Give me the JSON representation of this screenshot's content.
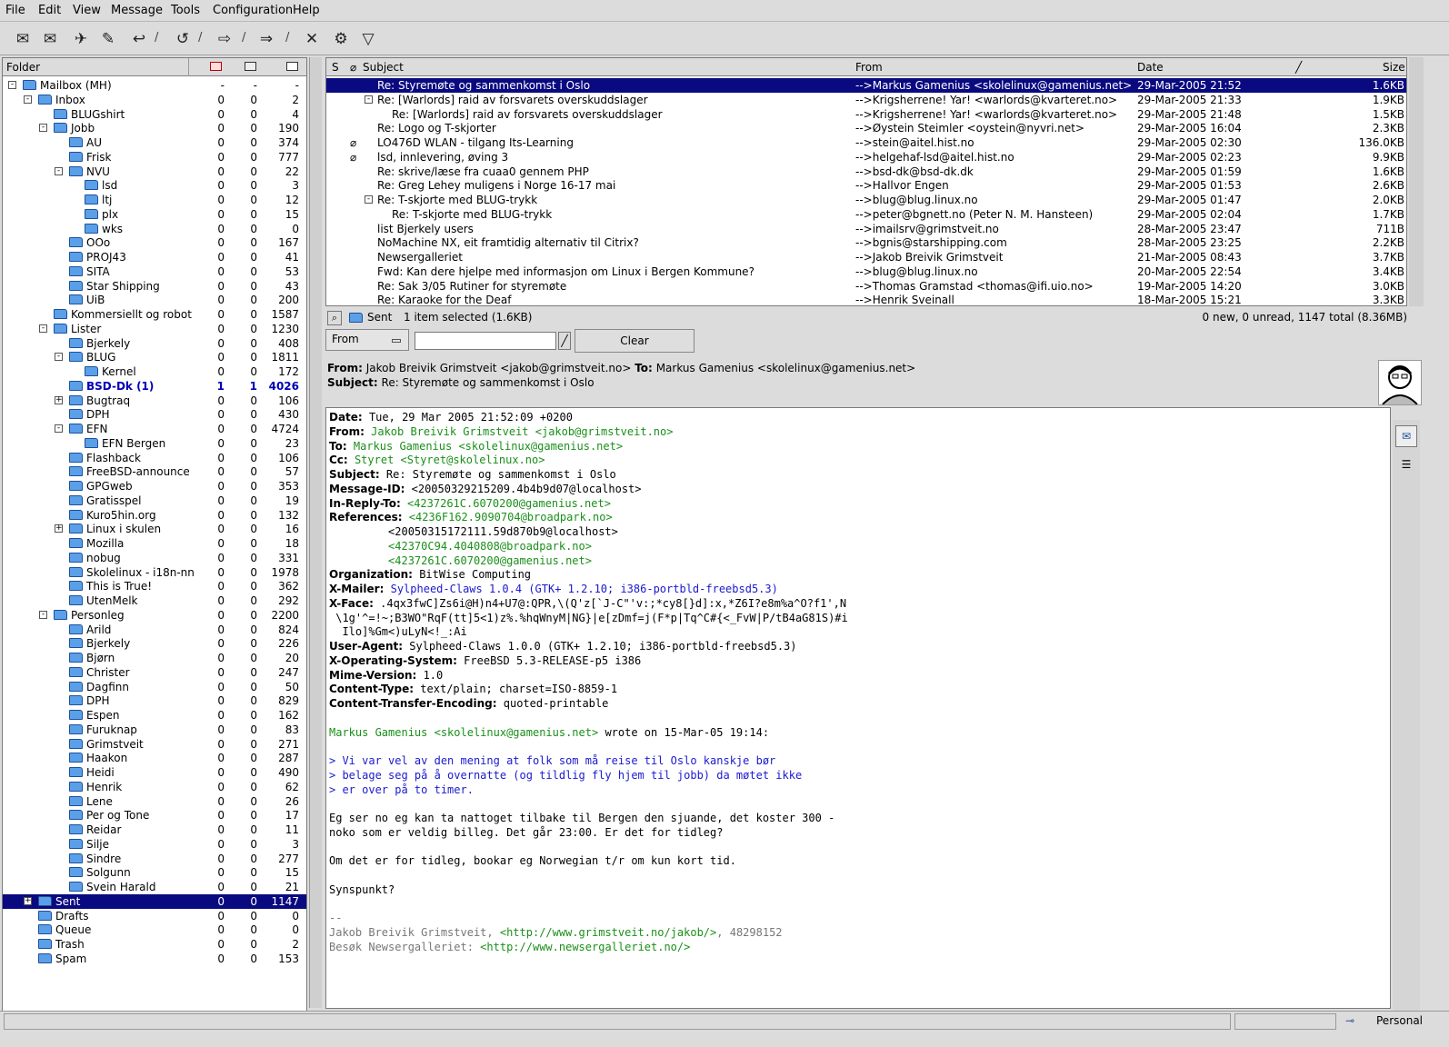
{
  "menu": [
    "File",
    "Edit",
    "View",
    "Message",
    "Tools",
    "Configuration",
    "Help"
  ],
  "toolbar_icons": [
    "get-mail-icon",
    "get-all-icon",
    "send-icon",
    "compose-icon",
    "reply-icon",
    "reply-all-icon",
    "forward-icon",
    "next-icon",
    "delete-icon",
    "execute-icon",
    "filter-icon"
  ],
  "folder_header": {
    "title": "Folder"
  },
  "folders": [
    {
      "name": "Mailbox (MH)",
      "n": "-",
      "u": "-",
      "t": "-",
      "level": 0,
      "exp": "-"
    },
    {
      "name": "Inbox",
      "n": "0",
      "u": "0",
      "t": "2",
      "level": 1,
      "exp": "-"
    },
    {
      "name": "BLUGshirt",
      "n": "0",
      "u": "0",
      "t": "4",
      "level": 2
    },
    {
      "name": "Jobb",
      "n": "0",
      "u": "0",
      "t": "190",
      "level": 2,
      "exp": "-"
    },
    {
      "name": "AU",
      "n": "0",
      "u": "0",
      "t": "374",
      "level": 3
    },
    {
      "name": "Frisk",
      "n": "0",
      "u": "0",
      "t": "777",
      "level": 3
    },
    {
      "name": "NVU",
      "n": "0",
      "u": "0",
      "t": "22",
      "level": 3,
      "exp": "-"
    },
    {
      "name": "lsd",
      "n": "0",
      "u": "0",
      "t": "3",
      "level": 4
    },
    {
      "name": "ltj",
      "n": "0",
      "u": "0",
      "t": "12",
      "level": 4
    },
    {
      "name": "plx",
      "n": "0",
      "u": "0",
      "t": "15",
      "level": 4
    },
    {
      "name": "wks",
      "n": "0",
      "u": "0",
      "t": "0",
      "level": 4
    },
    {
      "name": "OOo",
      "n": "0",
      "u": "0",
      "t": "167",
      "level": 3
    },
    {
      "name": "PROJ43",
      "n": "0",
      "u": "0",
      "t": "41",
      "level": 3
    },
    {
      "name": "SITA",
      "n": "0",
      "u": "0",
      "t": "53",
      "level": 3
    },
    {
      "name": "Star Shipping",
      "n": "0",
      "u": "0",
      "t": "43",
      "level": 3
    },
    {
      "name": "UiB",
      "n": "0",
      "u": "0",
      "t": "200",
      "level": 3
    },
    {
      "name": "Kommersiellt og robot",
      "n": "0",
      "u": "0",
      "t": "1587",
      "level": 2
    },
    {
      "name": "Lister",
      "n": "0",
      "u": "0",
      "t": "1230",
      "level": 2,
      "exp": "-"
    },
    {
      "name": "Bjerkely",
      "n": "0",
      "u": "0",
      "t": "408",
      "level": 3
    },
    {
      "name": "BLUG",
      "n": "0",
      "u": "0",
      "t": "1811",
      "level": 3,
      "exp": "-"
    },
    {
      "name": "Kernel",
      "n": "0",
      "u": "0",
      "t": "172",
      "level": 4
    },
    {
      "name": "BSD-Dk (1)",
      "n": "1",
      "u": "1",
      "t": "4026",
      "level": 3,
      "bold": true
    },
    {
      "name": "Bugtraq",
      "n": "0",
      "u": "0",
      "t": "106",
      "level": 3,
      "exp": "+"
    },
    {
      "name": "DPH",
      "n": "0",
      "u": "0",
      "t": "430",
      "level": 3
    },
    {
      "name": "EFN",
      "n": "0",
      "u": "0",
      "t": "4724",
      "level": 3,
      "exp": "-"
    },
    {
      "name": "EFN Bergen",
      "n": "0",
      "u": "0",
      "t": "23",
      "level": 4
    },
    {
      "name": "Flashback",
      "n": "0",
      "u": "0",
      "t": "106",
      "level": 3
    },
    {
      "name": "FreeBSD-announce",
      "n": "0",
      "u": "0",
      "t": "57",
      "level": 3
    },
    {
      "name": "GPGweb",
      "n": "0",
      "u": "0",
      "t": "353",
      "level": 3
    },
    {
      "name": "Gratisspel",
      "n": "0",
      "u": "0",
      "t": "19",
      "level": 3
    },
    {
      "name": "Kuro5hin.org",
      "n": "0",
      "u": "0",
      "t": "132",
      "level": 3
    },
    {
      "name": "Linux i skulen",
      "n": "0",
      "u": "0",
      "t": "16",
      "level": 3,
      "exp": "+"
    },
    {
      "name": "Mozilla",
      "n": "0",
      "u": "0",
      "t": "18",
      "level": 3
    },
    {
      "name": "nobug",
      "n": "0",
      "u": "0",
      "t": "331",
      "level": 3
    },
    {
      "name": "Skolelinux - i18n-nn",
      "n": "0",
      "u": "0",
      "t": "1978",
      "level": 3
    },
    {
      "name": "This is True!",
      "n": "0",
      "u": "0",
      "t": "362",
      "level": 3
    },
    {
      "name": "UtenMelk",
      "n": "0",
      "u": "0",
      "t": "292",
      "level": 3
    },
    {
      "name": "Personleg",
      "n": "0",
      "u": "0",
      "t": "2200",
      "level": 2,
      "exp": "-"
    },
    {
      "name": "Arild",
      "n": "0",
      "u": "0",
      "t": "824",
      "level": 3
    },
    {
      "name": "Bjerkely",
      "n": "0",
      "u": "0",
      "t": "226",
      "level": 3
    },
    {
      "name": "Bjørn",
      "n": "0",
      "u": "0",
      "t": "20",
      "level": 3
    },
    {
      "name": "Christer",
      "n": "0",
      "u": "0",
      "t": "247",
      "level": 3
    },
    {
      "name": "Dagfinn",
      "n": "0",
      "u": "0",
      "t": "50",
      "level": 3
    },
    {
      "name": "DPH",
      "n": "0",
      "u": "0",
      "t": "829",
      "level": 3
    },
    {
      "name": "Espen",
      "n": "0",
      "u": "0",
      "t": "162",
      "level": 3
    },
    {
      "name": "Furuknap",
      "n": "0",
      "u": "0",
      "t": "83",
      "level": 3
    },
    {
      "name": "Grimstveit",
      "n": "0",
      "u": "0",
      "t": "271",
      "level": 3
    },
    {
      "name": "Haakon",
      "n": "0",
      "u": "0",
      "t": "287",
      "level": 3
    },
    {
      "name": "Heidi",
      "n": "0",
      "u": "0",
      "t": "490",
      "level": 3
    },
    {
      "name": "Henrik",
      "n": "0",
      "u": "0",
      "t": "62",
      "level": 3
    },
    {
      "name": "Lene",
      "n": "0",
      "u": "0",
      "t": "26",
      "level": 3
    },
    {
      "name": "Per og Tone",
      "n": "0",
      "u": "0",
      "t": "17",
      "level": 3
    },
    {
      "name": "Reidar",
      "n": "0",
      "u": "0",
      "t": "11",
      "level": 3
    },
    {
      "name": "Silje",
      "n": "0",
      "u": "0",
      "t": "3",
      "level": 3
    },
    {
      "name": "Sindre",
      "n": "0",
      "u": "0",
      "t": "277",
      "level": 3
    },
    {
      "name": "Solgunn",
      "n": "0",
      "u": "0",
      "t": "15",
      "level": 3
    },
    {
      "name": "Svein Harald",
      "n": "0",
      "u": "0",
      "t": "21",
      "level": 3
    },
    {
      "name": "Sent",
      "n": "0",
      "u": "0",
      "t": "1147",
      "level": 1,
      "sel": true,
      "exp": "+"
    },
    {
      "name": "Drafts",
      "n": "0",
      "u": "0",
      "t": "0",
      "level": 1
    },
    {
      "name": "Queue",
      "n": "0",
      "u": "0",
      "t": "0",
      "level": 1
    },
    {
      "name": "Trash",
      "n": "0",
      "u": "0",
      "t": "2",
      "level": 1
    },
    {
      "name": "Spam",
      "n": "0",
      "u": "0",
      "t": "153",
      "level": 1
    }
  ],
  "list_header": {
    "s": "S",
    "subject": "Subject",
    "from": "From",
    "date": "Date",
    "size": "Size"
  },
  "messages": [
    {
      "subject": "Re: Styremøte og sammenkomst i Oslo",
      "from": "-->Markus Gamenius <skolelinux@gamenius.net>",
      "date": "29-Mar-2005 21:52",
      "size": "1.6KB",
      "sel": true,
      "indent": 1
    },
    {
      "subject": "Re: [Warlords] raid av forsvarets overskuddslager",
      "from": "-->Krigsherrene! Yar! <warlords@kvarteret.no>",
      "date": "29-Mar-2005 21:33",
      "size": "1.9KB",
      "indent": 1,
      "exp": true
    },
    {
      "subject": "Re: [Warlords] raid av forsvarets overskuddslager",
      "from": "-->Krigsherrene! Yar! <warlords@kvarteret.no>",
      "date": "29-Mar-2005 21:48",
      "size": "1.5KB",
      "indent": 2
    },
    {
      "subject": "Re: Logo og T-skjorter",
      "from": "-->Øystein Steimler <oystein@nyvri.net>",
      "date": "29-Mar-2005 16:04",
      "size": "2.3KB",
      "indent": 1
    },
    {
      "subject": "LO476D WLAN - tilgang Its-Learning",
      "from": "-->stein@aitel.hist.no",
      "date": "29-Mar-2005 02:30",
      "size": "136.0KB",
      "clip": true,
      "indent": 1
    },
    {
      "subject": "lsd, innlevering, øving 3",
      "from": "-->helgehaf-lsd@aitel.hist.no",
      "date": "29-Mar-2005 02:23",
      "size": "9.9KB",
      "clip": true,
      "indent": 1
    },
    {
      "subject": "Re: skrive/læse fra cuaa0 gennem PHP",
      "from": "-->bsd-dk@bsd-dk.dk",
      "date": "29-Mar-2005 01:59",
      "size": "1.6KB",
      "indent": 1
    },
    {
      "subject": "Re: Greg Lehey muligens i Norge 16-17 mai",
      "from": "-->Hallvor Engen",
      "date": "29-Mar-2005 01:53",
      "size": "2.6KB",
      "indent": 1
    },
    {
      "subject": "Re: T-skjorte med BLUG-trykk",
      "from": "-->blug@blug.linux.no",
      "date": "29-Mar-2005 01:47",
      "size": "2.0KB",
      "indent": 1,
      "exp": true
    },
    {
      "subject": "Re: T-skjorte med BLUG-trykk",
      "from": "-->peter@bgnett.no (Peter N. M. Hansteen)",
      "date": "29-Mar-2005 02:04",
      "size": "1.7KB",
      "indent": 2
    },
    {
      "subject": "list Bjerkely users",
      "from": "-->imailsrv@grimstveit.no",
      "date": "28-Mar-2005 23:47",
      "size": "711B",
      "indent": 1
    },
    {
      "subject": "NoMachine NX, eit framtidig alternativ til Citrix?",
      "from": "-->bgnis@starshipping.com",
      "date": "28-Mar-2005 23:25",
      "size": "2.2KB",
      "indent": 1
    },
    {
      "subject": "Newsergalleriet",
      "from": "-->Jakob Breivik Grimstveit",
      "date": "21-Mar-2005 08:43",
      "size": "3.7KB",
      "indent": 1
    },
    {
      "subject": "Fwd: Kan dere hjelpe med informasjon om Linux i Bergen Kommune?",
      "from": "-->blug@blug.linux.no",
      "date": "20-Mar-2005 22:54",
      "size": "3.4KB",
      "indent": 1
    },
    {
      "subject": "Re: Sak 3/05 Rutiner for styremøte",
      "from": "-->Thomas Gramstad <thomas@ifi.uio.no>",
      "date": "19-Mar-2005 14:20",
      "size": "3.0KB",
      "indent": 1
    },
    {
      "subject": "Re: Karaoke for the Deaf",
      "from": "-->Henrik Sveinall",
      "date": "18-Mar-2005 15:21",
      "size": "3.3KB",
      "indent": 1
    }
  ],
  "status": {
    "folder": "Sent",
    "selected": "1 item selected (1.6KB)",
    "totals": "0 new, 0 unread, 1147 total (8.36MB)"
  },
  "filter": {
    "field": "From",
    "value": "",
    "clear": "Clear"
  },
  "summary": {
    "from_label": "From:",
    "from": "Jakob Breivik Grimstveit <jakob@grimstveit.no>",
    "to_label": "To:",
    "to": "Markus Gamenius <skolelinux@gamenius.net>",
    "subject_label": "Subject:",
    "subject": "Re: Styremøte og sammenkomst i Oslo"
  },
  "body_lines": [
    {
      "label": "Date:",
      "text": " Tue, 29 Mar 2005 21:52:09 +0200"
    },
    {
      "label": "From:",
      "text": " Jakob Breivik Grimstveit <jakob@grimstveit.no>",
      "cls": "green"
    },
    {
      "label": "To:",
      "text": " Markus Gamenius <skolelinux@gamenius.net>",
      "cls": "green"
    },
    {
      "label": "Cc:",
      "text": " Styret <Styret@skolelinux.no>",
      "cls": "green"
    },
    {
      "label": "Subject:",
      "text": " Re: Styremøte og sammenkomst i Oslo"
    },
    {
      "label": "Message-ID:",
      "text": " <20050329215209.4b4b9d07@localhost>"
    },
    {
      "label": "In-Reply-To:",
      "text": " <4237261C.6070200@gamenius.net>",
      "cls": "green"
    },
    {
      "label": "References:",
      "text": " <4236F162.9090704@broadpark.no>",
      "cls": "green"
    },
    {
      "label": "",
      "text": "         <20050315172111.59d870b9@localhost>"
    },
    {
      "label": "",
      "text": "         <42370C94.4040808@broadpark.no>",
      "cls": "green"
    },
    {
      "label": "",
      "text": "         <4237261C.6070200@gamenius.net>",
      "cls": "green"
    },
    {
      "label": "Organization:",
      "text": " BitWise Computing"
    },
    {
      "label": "X-Mailer:",
      "text": " Sylpheed-Claws 1.0.4 (GTK+ 1.2.10; i386-portbld-freebsd5.3)",
      "cls": "blue"
    },
    {
      "label": "X-Face:",
      "text": " .4qx3fwC]Zs6i@H)n4+U7@:QPR,\\(Q'z[`J-C\"'v:;*cy8[}d]:x,*Z6I?e8m%a^O?f1',N"
    },
    {
      "label": "",
      "text": " \\1g'^=!~;B3WO\"RqF(tt]5<1)z%.%hqWnyM|NG}|e[zDmf=j(F*p|Tq^C#{<_FvW|P/tB4aG81S)#i"
    },
    {
      "label": "",
      "text": "  Ilo]%Gm<)uLyN<!_:Ai"
    },
    {
      "label": "User-Agent:",
      "text": " Sylpheed-Claws 1.0.0 (GTK+ 1.2.10; i386-portbld-freebsd5.3)"
    },
    {
      "label": "X-Operating-System:",
      "text": " FreeBSD 5.3-RELEASE-p5 i386"
    },
    {
      "label": "Mime-Version:",
      "text": " 1.0"
    },
    {
      "label": "Content-Type:",
      "text": " text/plain; charset=ISO-8859-1"
    },
    {
      "label": "Content-Transfer-Encoding:",
      "text": " quoted-printable"
    },
    {
      "label": "",
      "text": ""
    },
    {
      "label": "",
      "text": "Markus Gamenius <skolelinux@gamenius.net>",
      "cls": "green",
      "suffix": " wrote on 15-Mar-05 19:14:"
    },
    {
      "label": "",
      "text": ""
    },
    {
      "label": "",
      "text": "> Vi var vel av den mening at folk som må reise til Oslo kanskje bør",
      "cls": "blue"
    },
    {
      "label": "",
      "text": "> belage seg på å overnatte (og tildlig fly hjem til jobb) da møtet ikke",
      "cls": "blue"
    },
    {
      "label": "",
      "text": "> er over på to timer.",
      "cls": "blue"
    },
    {
      "label": "",
      "text": ""
    },
    {
      "label": "",
      "text": "Eg ser no eg kan ta nattoget tilbake til Bergen den sjuande, det koster 300 -"
    },
    {
      "label": "",
      "text": "noko som er veldig billeg. Det går 23:00. Er det for tidleg?"
    },
    {
      "label": "",
      "text": ""
    },
    {
      "label": "",
      "text": "Om det er for tidleg, bookar eg Norwegian t/r om kun kort tid."
    },
    {
      "label": "",
      "text": ""
    },
    {
      "label": "",
      "text": "Synspunkt?"
    },
    {
      "label": "",
      "text": ""
    },
    {
      "label": "",
      "text": "--",
      "cls": "grey"
    },
    {
      "label": "",
      "text": "Jakob Breivik Grimstveit, ",
      "cls": "grey",
      "link": "<http://www.grimstveit.no/jakob/>",
      "suffix2": ", 48298152"
    },
    {
      "label": "",
      "text": "Besøk Newsergalleriet: ",
      "cls": "grey",
      "link": "<http://www.newsergalleriet.no/>"
    }
  ],
  "bottom": {
    "account": "Personal"
  }
}
